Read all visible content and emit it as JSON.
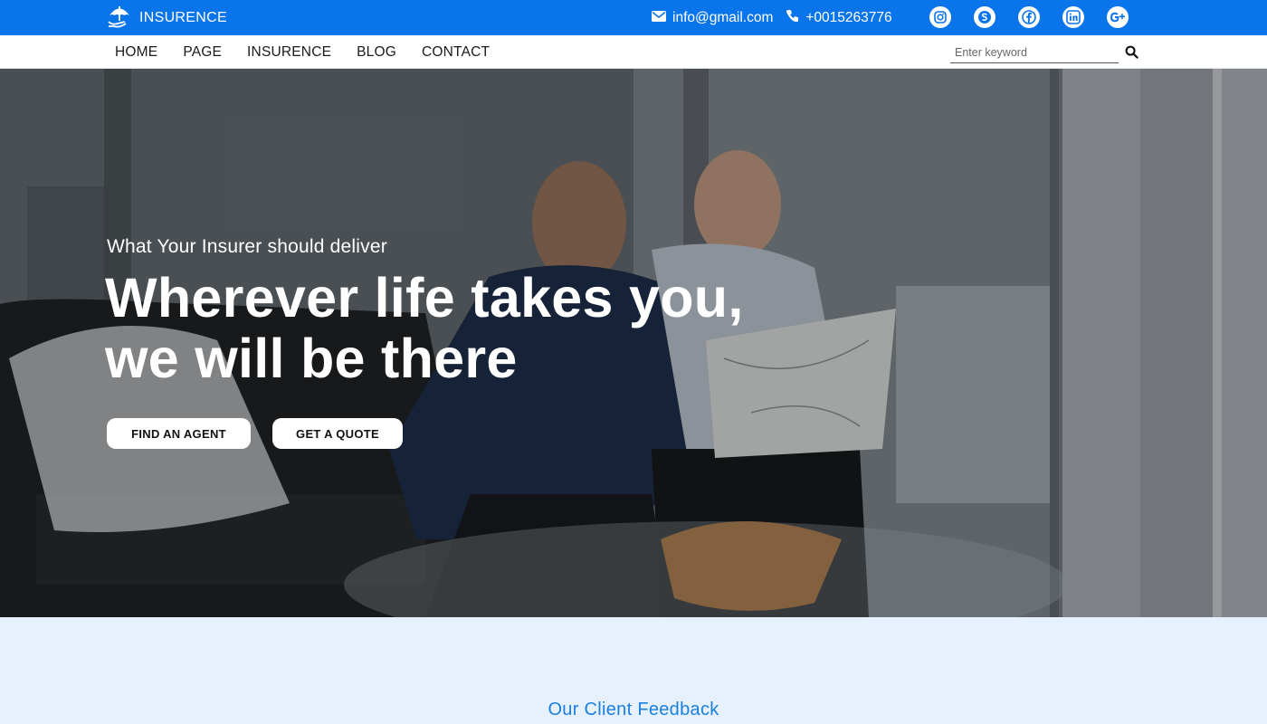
{
  "brand": {
    "name": "INSURENCE"
  },
  "topbar": {
    "email": "info@gmail.com",
    "phone": "+0015263776",
    "socials": [
      "instagram-icon",
      "skype-icon",
      "facebook-icon",
      "linkedin-icon",
      "google-plus-icon"
    ]
  },
  "nav": {
    "items": [
      {
        "label": "HOME"
      },
      {
        "label": "PAGE"
      },
      {
        "label": "INSURENCE"
      },
      {
        "label": "BLOG"
      },
      {
        "label": "CONTACT"
      }
    ],
    "search_placeholder": "Enter keyword"
  },
  "hero": {
    "subtitle": "What Your Insurer should deliver",
    "title_line1": "Wherever life takes you,",
    "title_line2": "we will be there",
    "find_agent": "FIND AN AGENT",
    "get_quote": "GET A QUOTE"
  },
  "feedback": {
    "title": "Our Client Feedback"
  },
  "colors": {
    "primary": "#0a74ea",
    "feedback_bg": "#e6f1fd",
    "feedback_title": "#1b7fe0"
  }
}
